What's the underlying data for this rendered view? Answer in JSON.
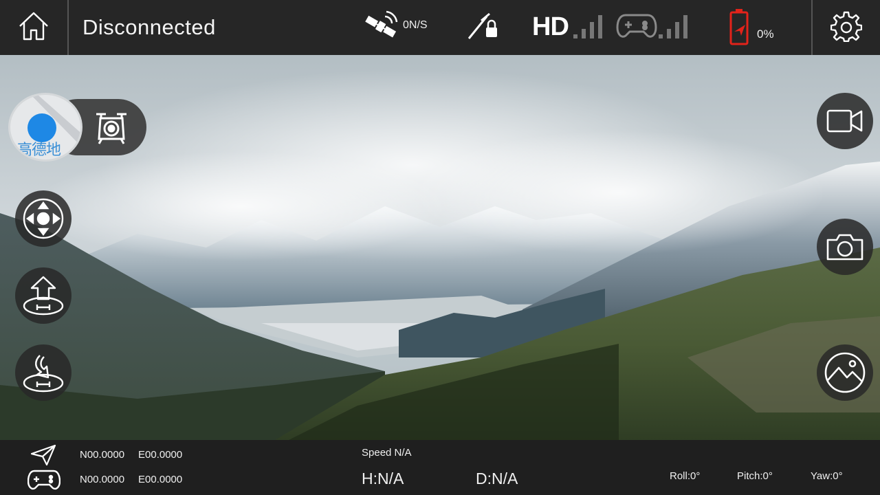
{
  "topbar": {
    "status": "Disconnected",
    "gps_satellites": "0N/S",
    "video_quality_label": "HD",
    "battery_percent": "0%",
    "colors": {
      "bar_bg": "#262626",
      "battery_alert": "#e2231a"
    }
  },
  "left_controls": {
    "map_thumbnail_text": "高德地",
    "items": [
      "map-switch",
      "joystick-mode",
      "takeoff",
      "return-to-home"
    ]
  },
  "right_controls": {
    "items": [
      "record-video",
      "take-photo",
      "gallery"
    ]
  },
  "telemetry": {
    "drone_lat": "N00.0000",
    "drone_lon": "E00.0000",
    "remote_lat": "N00.0000",
    "remote_lon": "E00.0000",
    "speed": "Speed N/A",
    "height": "H:N/A",
    "distance": "D:N/A",
    "roll": "Roll:0°",
    "pitch": "Pitch:0°",
    "yaw": "Yaw:0°"
  }
}
